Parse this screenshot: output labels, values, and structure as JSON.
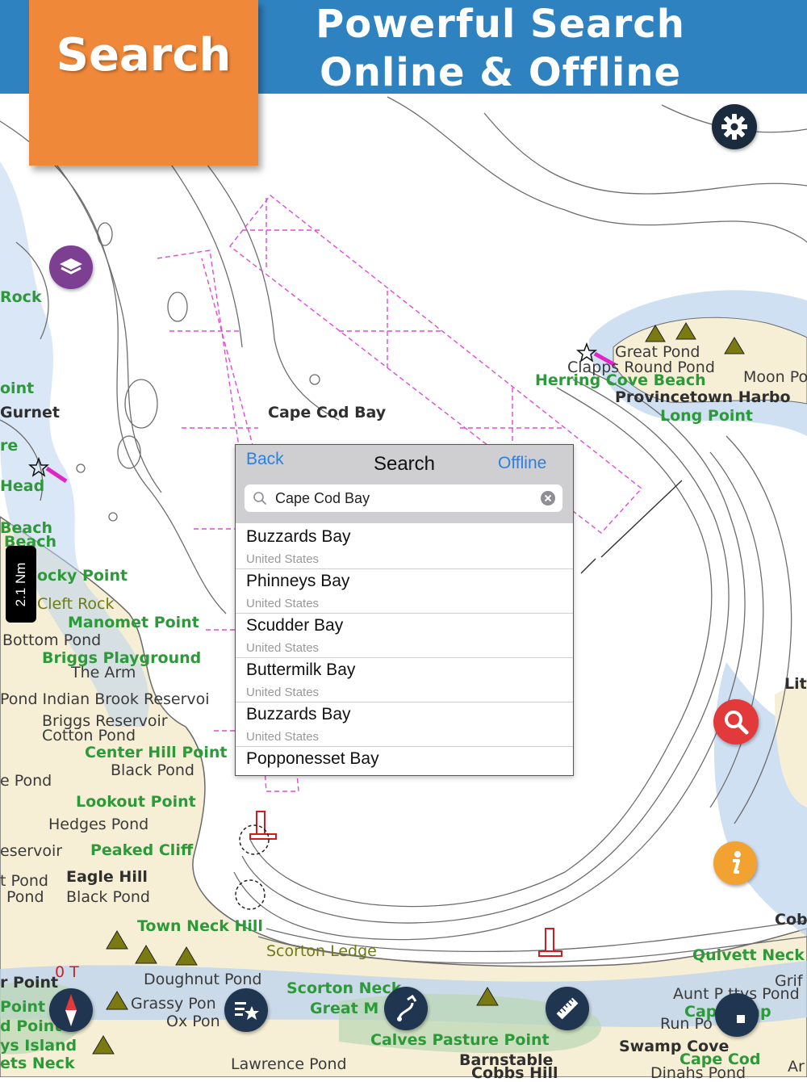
{
  "header": {
    "tag_label": "Search",
    "headline_line1": "Powerful Search",
    "headline_line2": "Online & Offline"
  },
  "map": {
    "labels": [
      {
        "id": "cape-cod-bay",
        "text": "Cape Cod Bay",
        "style": "bold"
      },
      {
        "id": "great-pond",
        "text": "Great Pond",
        "style": "plain"
      },
      {
        "id": "clapps-round-pond",
        "text": "Clapps Round Pond",
        "style": "plain"
      },
      {
        "id": "herring-cove-beach",
        "text": "Herring Cove Beach",
        "style": "green"
      },
      {
        "id": "moon-pond",
        "text": "Moon Po",
        "style": "plain"
      },
      {
        "id": "provincetown-harbor",
        "text": "Provincetown Harbo",
        "style": "bold"
      },
      {
        "id": "long-point",
        "text": "Long Point",
        "style": "green"
      },
      {
        "id": "rock",
        "text": "Rock",
        "style": "green"
      },
      {
        "id": "oint",
        "text": "oint",
        "style": "green"
      },
      {
        "id": "gurnet",
        "text": "Gurnet",
        "style": "bold"
      },
      {
        "id": "re",
        "text": "re",
        "style": "green"
      },
      {
        "id": "head",
        "text": "Head",
        "style": "green"
      },
      {
        "id": "beach-1",
        "text": "Beach",
        "style": "green"
      },
      {
        "id": "beach-2",
        "text": "Beach",
        "style": "green"
      },
      {
        "id": "rocky-point",
        "text": "ocky Point",
        "style": "green"
      },
      {
        "id": "cleft-rock",
        "text": "Cleft Rock",
        "style": "olive"
      },
      {
        "id": "manomet-point",
        "text": "Manomet Point",
        "style": "green"
      },
      {
        "id": "bottom-pond",
        "text": "Bottom Pond",
        "style": "plain"
      },
      {
        "id": "briggs-playground",
        "text": "Briggs Playground",
        "style": "green"
      },
      {
        "id": "the-arm",
        "text": "The Arm",
        "style": "plain"
      },
      {
        "id": "indian-brook",
        "text": "Pond  Indian Brook Reservoi",
        "style": "plain"
      },
      {
        "id": "briggs-reservoir",
        "text": "Briggs Reservoir",
        "style": "plain"
      },
      {
        "id": "cotton-pond",
        "text": "Cotton Pond",
        "style": "plain"
      },
      {
        "id": "center-hill-point",
        "text": "Center Hill Point",
        "style": "green"
      },
      {
        "id": "black-pond-1",
        "text": "Black Pond",
        "style": "plain"
      },
      {
        "id": "e-pond",
        "text": "e Pond",
        "style": "plain"
      },
      {
        "id": "lookout-point",
        "text": "Lookout Point",
        "style": "green"
      },
      {
        "id": "hedges-pond",
        "text": "Hedges Pond",
        "style": "plain"
      },
      {
        "id": "eservoir",
        "text": "eservoir",
        "style": "plain"
      },
      {
        "id": "peaked-cliff",
        "text": "Peaked Cliff",
        "style": "green"
      },
      {
        "id": "eagle-hill",
        "text": "Eagle Hill",
        "style": "bold"
      },
      {
        "id": "black-pond-2",
        "text": "Black Pond",
        "style": "plain"
      },
      {
        "id": "town-neck-hill",
        "text": "Town Neck Hill",
        "style": "green"
      },
      {
        "id": "scorton-ledge",
        "text": "Scorton Ledge",
        "style": "olive"
      },
      {
        "id": "doughnut-pond",
        "text": "Doughnut Pond",
        "style": "plain"
      },
      {
        "id": "grassy-pond",
        "text": "Grassy Pon",
        "style": "plain"
      },
      {
        "id": "ox-pond",
        "text": "Ox Pon",
        "style": "plain"
      },
      {
        "id": "scorton-neck",
        "text": "Scorton Neck",
        "style": "green"
      },
      {
        "id": "great-marshes",
        "text": "Great M        es",
        "style": "green"
      },
      {
        "id": "calves-pasture-point",
        "text": "Calves Pasture Point",
        "style": "green"
      },
      {
        "id": "barnstable",
        "text": "Barnstable",
        "style": "bold"
      },
      {
        "id": "cobbs-hill",
        "text": "Cobbs Hill",
        "style": "bold"
      },
      {
        "id": "lawrence-pond",
        "text": "Lawrence Pond",
        "style": "plain"
      },
      {
        "id": "quivett-neck",
        "text": "Quivett Neck",
        "style": "green"
      },
      {
        "id": "aunt-pattys-pond",
        "text": "Aunt P  ttys Pond",
        "style": "plain"
      },
      {
        "id": "cape-cod",
        "text": "Cap    d Cap",
        "style": "green"
      },
      {
        "id": "run-pond",
        "text": "Run Po",
        "style": "plain"
      },
      {
        "id": "swamp-cove",
        "text": "Swamp Cove",
        "style": "bold"
      },
      {
        "id": "cape-cod-2",
        "text": "Cape Cod",
        "style": "green"
      },
      {
        "id": "dinahs-pond",
        "text": "Dinahs Pond",
        "style": "plain"
      },
      {
        "id": "point-left-1",
        "text": "r Point",
        "style": "bold"
      },
      {
        "id": "point-left-2",
        "text": "Point",
        "style": "green"
      },
      {
        "id": "point-left-3",
        "text": "d Point",
        "style": "green"
      },
      {
        "id": "ys-island",
        "text": "ys Island",
        "style": "green"
      },
      {
        "id": "ets-neck",
        "text": "ets Neck",
        "style": "green"
      },
      {
        "id": "lit",
        "text": "Lit",
        "style": "bold"
      },
      {
        "id": "cob",
        "text": "Cob",
        "style": "bold"
      },
      {
        "id": "grif",
        "text": "Grif",
        "style": "plain"
      },
      {
        "id": "ar",
        "text": "Ar",
        "style": "plain"
      },
      {
        "id": "pond-left-1",
        "text": "t Pond",
        "style": "plain"
      },
      {
        "id": "pond-left-2",
        "text": "Pond",
        "style": "plain"
      },
      {
        "id": "zero-t",
        "text": "0  T",
        "style": "red"
      }
    ],
    "scale_label": "2.1 Nm"
  },
  "search_panel": {
    "back_label": "Back",
    "title": "Search",
    "offline_label": "Offline",
    "query": "Cape Cod Bay",
    "results": [
      {
        "name": "Buzzards Bay",
        "country": "United States"
      },
      {
        "name": "Phinneys Bay",
        "country": "United States"
      },
      {
        "name": "Scudder Bay",
        "country": "United States"
      },
      {
        "name": "Buttermilk Bay",
        "country": "United States"
      },
      {
        "name": "Buzzards Bay",
        "country": "United States"
      },
      {
        "name": "Popponesset Bay",
        "country": ""
      }
    ]
  },
  "colors": {
    "banner_blue": "#2f82c0",
    "tag_orange": "#f0883a",
    "land": "#f6efd5",
    "water": "#bcd3ee",
    "settings": "#1b2b3e",
    "layers": "#7c3f91",
    "search_fab": "#e23a3a",
    "info_fab": "#f2a230",
    "link_blue": "#2a7fe6"
  }
}
